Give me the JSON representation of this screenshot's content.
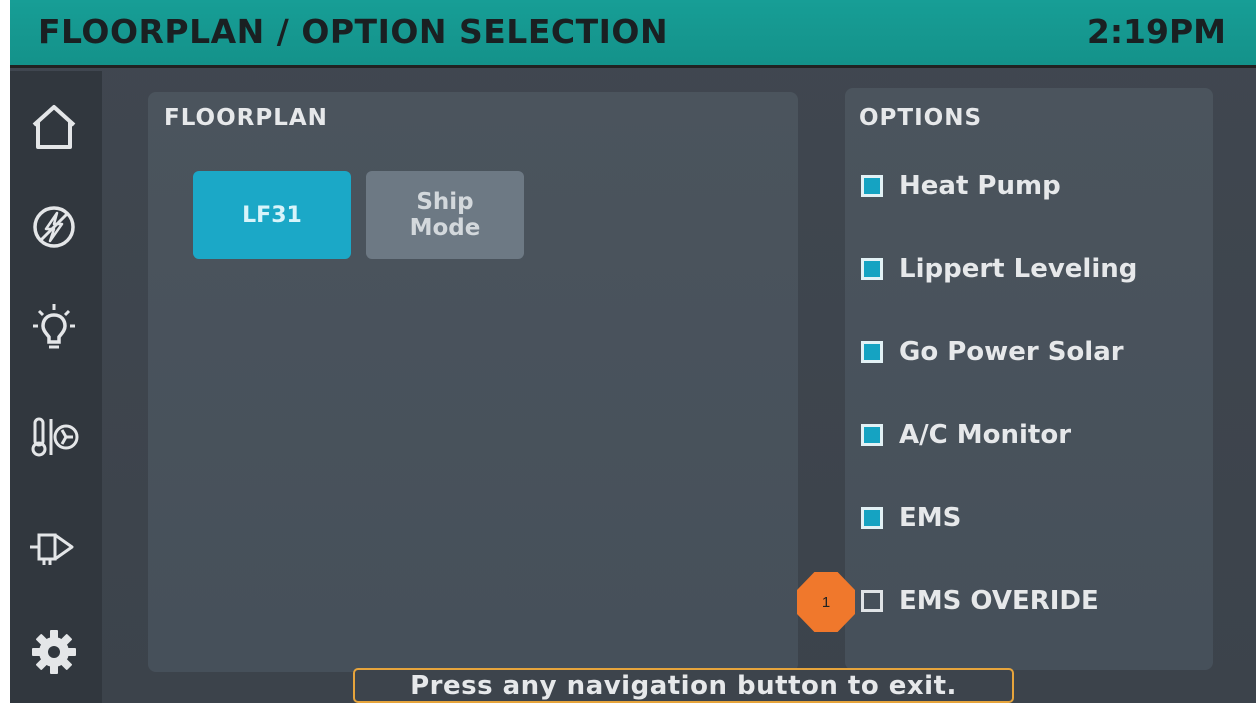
{
  "header": {
    "title": "FLOORPLAN / OPTION SELECTION",
    "clock": "2:19PM",
    "color": "#179e96"
  },
  "sidebar": {
    "items": [
      {
        "icon": "home-icon"
      },
      {
        "icon": "power-icon"
      },
      {
        "icon": "light-bulb-icon"
      },
      {
        "icon": "climate-icon"
      },
      {
        "icon": "slideout-icon"
      },
      {
        "icon": "gear-icon"
      }
    ]
  },
  "floorplan": {
    "title": "FLOORPLAN",
    "buttons": [
      {
        "label": "LF31",
        "selected": true
      },
      {
        "label_line1": "Ship",
        "label_line2": "Mode",
        "selected": false
      }
    ]
  },
  "options": {
    "title": "OPTIONS",
    "items": [
      {
        "label": "Heat Pump",
        "checked": true
      },
      {
        "label": "Lippert Leveling",
        "checked": true
      },
      {
        "label": "Go Power Solar",
        "checked": true
      },
      {
        "label": "A/C Monitor",
        "checked": true
      },
      {
        "label": "EMS",
        "checked": true
      },
      {
        "label": "EMS OVERIDE",
        "checked": false
      }
    ],
    "accent_color": "#15a3c2"
  },
  "callout": {
    "number": "1",
    "color": "#f0782c"
  },
  "footer": {
    "hint": "Press any navigation button to exit.",
    "border_color": "#e6a43c"
  }
}
